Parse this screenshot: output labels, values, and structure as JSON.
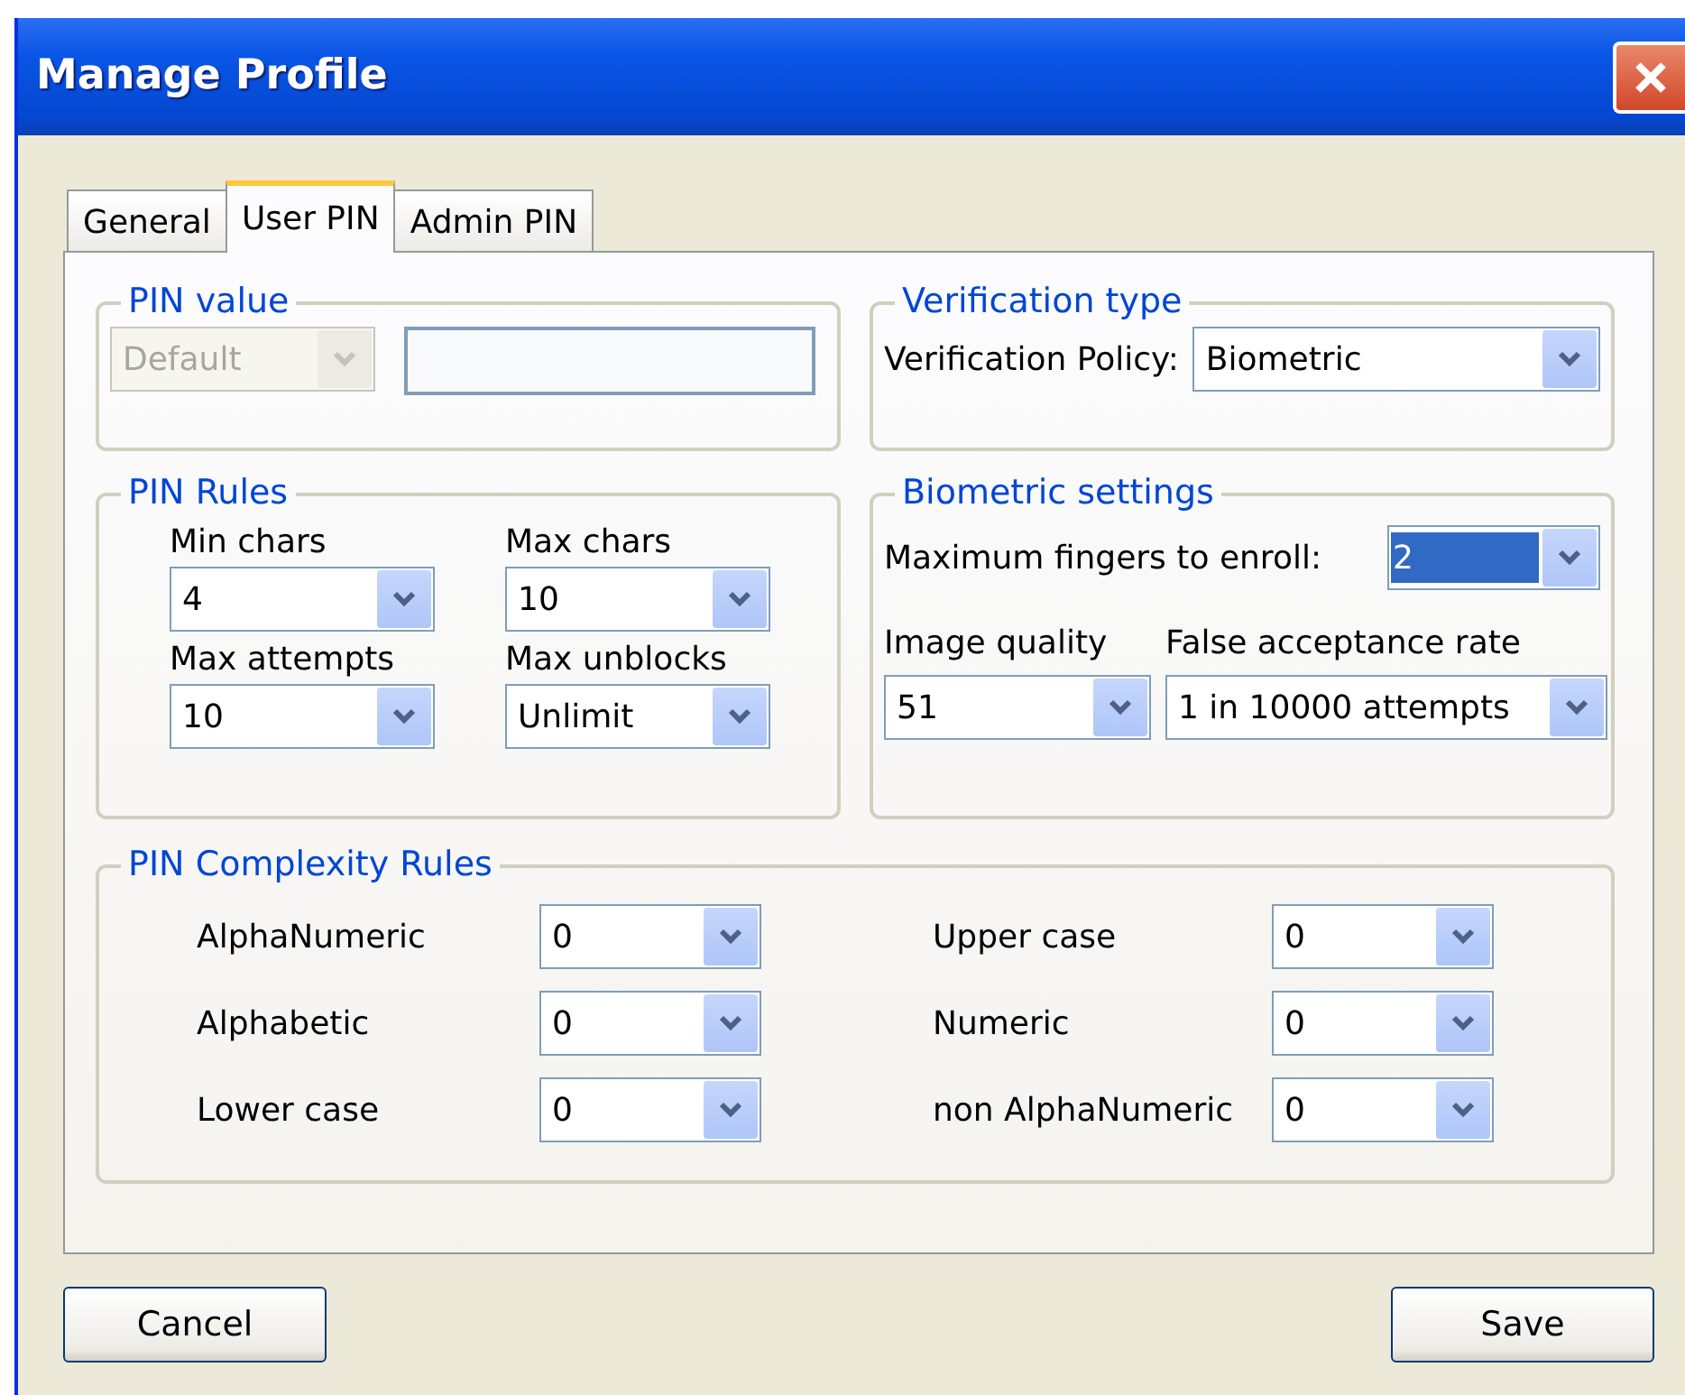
{
  "window": {
    "title": "Manage Profile"
  },
  "tabs": [
    {
      "label": "General",
      "selected": false
    },
    {
      "label": "User PIN",
      "selected": true
    },
    {
      "label": "Admin PIN",
      "selected": false
    }
  ],
  "pin_value": {
    "title": "PIN value",
    "combo": {
      "value": "Default",
      "disabled": true
    }
  },
  "verification_type": {
    "title": "Verification type",
    "label": "Verification Policy:",
    "combo": {
      "value": "Biometric"
    }
  },
  "pin_rules": {
    "title": "PIN Rules",
    "fields": [
      {
        "label": "Min chars",
        "value": "4"
      },
      {
        "label": "Max chars",
        "value": "10"
      },
      {
        "label": "Max attempts",
        "value": "10"
      },
      {
        "label": "Max unblocks",
        "value": "Unlimit"
      }
    ]
  },
  "biometric_settings": {
    "title": "Biometric settings",
    "fingers": {
      "label": "Maximum fingers to enroll:",
      "value": "2",
      "selected": true
    },
    "fields": [
      {
        "label": "Image quality",
        "value": "51"
      },
      {
        "label": "False acceptance rate",
        "value": "1 in 10000 attempts"
      }
    ]
  },
  "complexity_rules": {
    "title": "PIN Complexity Rules",
    "fields": [
      {
        "label": "AlphaNumeric",
        "value": "0"
      },
      {
        "label": "Upper case",
        "value": "0"
      },
      {
        "label": "Alphabetic",
        "value": "0"
      },
      {
        "label": "Numeric",
        "value": "0"
      },
      {
        "label": "Lower case",
        "value": "0"
      },
      {
        "label": "non AlphaNumeric",
        "value": "0"
      }
    ]
  },
  "buttons": [
    {
      "label": "Cancel"
    },
    {
      "label": "Save"
    }
  ]
}
